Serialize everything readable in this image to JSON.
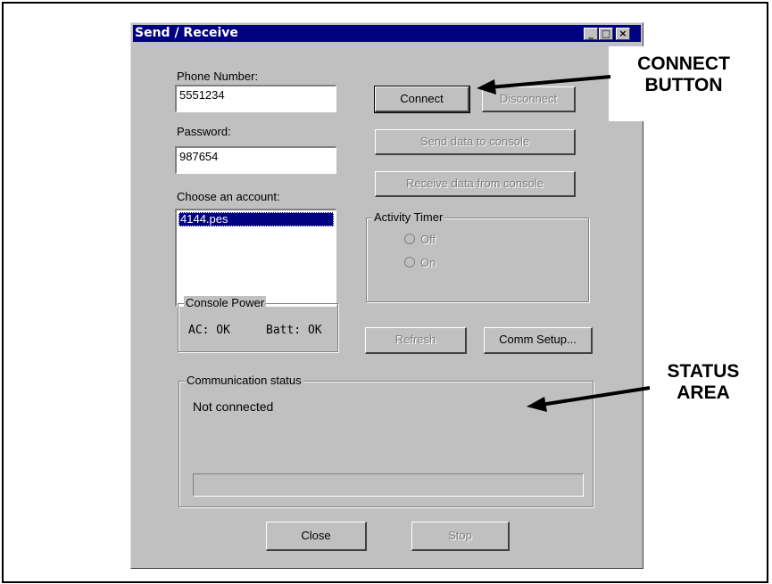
{
  "window": {
    "title": "Send / Receive",
    "controls": {
      "minimize": "_",
      "maximize": "□",
      "close": "×"
    }
  },
  "phone": {
    "label": "Phone Number:",
    "value": "5551234"
  },
  "password": {
    "label": "Password:",
    "value": "987654"
  },
  "account": {
    "label": "Choose an account:",
    "items": [
      "4144.pes"
    ],
    "selected": "4144.pes"
  },
  "buttons": {
    "connect": "Connect",
    "disconnect": "Disconnect",
    "send": "Send data to console",
    "receive": "Receive data from console",
    "refresh": "Refresh",
    "comm_setup": "Comm Setup...",
    "close": "Close",
    "stop": "Stop"
  },
  "activity_timer": {
    "title": "Activity Timer",
    "options": [
      "Off",
      "On"
    ]
  },
  "console_power": {
    "title": "Console Power",
    "ac": "AC: OK",
    "batt": "Batt: OK"
  },
  "comm_status": {
    "title": "Communication status",
    "text": "Not connected",
    "progress": 0
  },
  "callouts": {
    "connect_line1": "CONNECT",
    "connect_line2": "BUTTON",
    "status_line1": "STATUS",
    "status_line2": "AREA"
  }
}
